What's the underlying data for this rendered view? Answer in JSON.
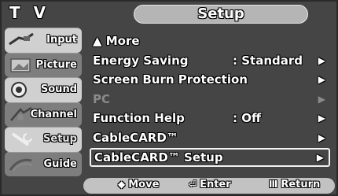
{
  "header": {
    "source_label": "T V",
    "menu_title": "Setup"
  },
  "sidebar": {
    "items": [
      {
        "label": "Input",
        "icon": "input-cable-icon"
      },
      {
        "label": "Picture",
        "icon": "picture-icon"
      },
      {
        "label": "Sound",
        "icon": "speaker-icon"
      },
      {
        "label": "Channel",
        "icon": "channel-icon"
      },
      {
        "label": "Setup",
        "icon": "setup-icon",
        "active": true
      },
      {
        "label": "Guide",
        "icon": "guide-icon"
      }
    ]
  },
  "menu": {
    "items": [
      {
        "label": "▲ More",
        "value": "",
        "arrow": ""
      },
      {
        "label": "Energy Saving",
        "value": ": Standard",
        "arrow": "▶"
      },
      {
        "label": "Screen Burn Protection",
        "value": "",
        "arrow": "▶"
      },
      {
        "label": "PC",
        "value": "",
        "arrow": "▶",
        "disabled": true
      },
      {
        "label": "Function Help",
        "value": ": Off",
        "arrow": "▶"
      },
      {
        "label": "CableCARD™",
        "value": "",
        "arrow": "▶"
      },
      {
        "label": "CableCARD™ Setup",
        "value": "",
        "arrow": "▶",
        "selected": true
      }
    ]
  },
  "footer": {
    "move_icon": "◆",
    "move_label": "Move",
    "enter_icon": "⏎",
    "enter_label": "Enter",
    "return_icon": "Ⅲ",
    "return_label": "Return"
  },
  "colors": {
    "background": "#454545",
    "sidebar_light": "#d0d0d0",
    "sidebar_dark": "#7e7e7e",
    "title_pill": "#b5b5b5",
    "footer_bar": "#c2c2c2",
    "disabled_text": "#8a8a8a"
  }
}
